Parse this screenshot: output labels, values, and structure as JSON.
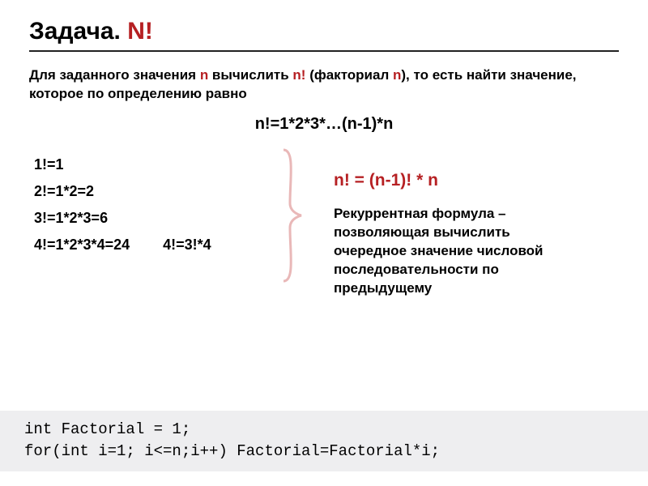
{
  "title": {
    "prefix": "Задача. ",
    "red": "N!"
  },
  "intro": {
    "p1": "Для заданного значения ",
    "n1": "n",
    "p2": " вычислить ",
    "nf": "n!",
    "p3": " (факториал ",
    "n2": "n",
    "p4": "), то есть найти значение, которое по определению равно"
  },
  "formula": "n!=1*2*3*…(n-1)*n",
  "facts": {
    "l1": "1!=1",
    "l2": "2!=1*2=2",
    "l3": "3!=1*2*3=6",
    "l4": "4!=1*2*3*4=24",
    "l4b": "4!=3!*4"
  },
  "recur_formula": "n! = (n-1)! * n",
  "recur_text": "Рекуррентная формула – позволяющая вычислить очередное значение числовой последовательности по предыдущему",
  "code": {
    "line1": "int Factorial = 1;",
    "line2": "for(int i=1; i<=n;i++) Factorial=Factorial*i;"
  }
}
